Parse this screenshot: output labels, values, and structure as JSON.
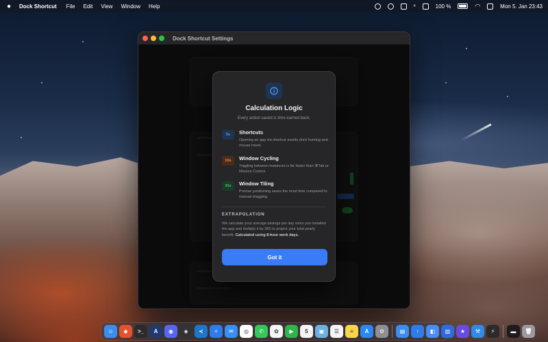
{
  "menubar": {
    "app_name": "Dock Shortcut",
    "menus": [
      "File",
      "Edit",
      "View",
      "Window",
      "Help"
    ],
    "battery": "100 %",
    "datetime": "Mon 5. Jan  23:43"
  },
  "window": {
    "title": "Dock Shortcut Settings"
  },
  "modal": {
    "icon": "info-icon",
    "title": "Calculation Logic",
    "subtitle": "Every action saved is time earned back.",
    "rows": [
      {
        "badge": "5s",
        "badge_color": "#5b9cf5",
        "title": "Shortcuts",
        "desc": "Opening an app via shortcut avoids dock hunting and mouse travel."
      },
      {
        "badge": "10s",
        "badge_color": "#f08a3c",
        "title": "Window Cycling",
        "desc": "Toggling between instances is far faster than ⌘Tab or Mission Control."
      },
      {
        "badge": "30s",
        "badge_color": "#4cc46a",
        "title": "Window Tiling",
        "desc": "Precise positioning saves the most time compared to manual dragging."
      }
    ],
    "extrapolation": {
      "heading": "EXTRAPOLATION",
      "body": "We calculate your average savings per day since you installed the app and multiply it by 365 to project your total yearly benefit.",
      "bold": "Calculated using 8-hour work days."
    },
    "button_label": "Got it",
    "button_color": "#3a7cf5"
  },
  "dock": {
    "icons": [
      {
        "name": "finder-icon",
        "color": "#3b8ef0",
        "glyph": "☺"
      },
      {
        "name": "brave-icon",
        "color": "#e2532d",
        "glyph": "◆"
      },
      {
        "name": "terminal-icon",
        "color": "#2b2b2b",
        "glyph": ">_"
      },
      {
        "name": "font-app-icon",
        "color": "#1e3a6e",
        "glyph": "A"
      },
      {
        "name": "discord-icon",
        "color": "#5865f2",
        "glyph": "◉"
      },
      {
        "name": "unity-icon",
        "color": "#333333",
        "glyph": "◈"
      },
      {
        "name": "vscode-icon",
        "color": "#1f76c9",
        "glyph": "≺"
      },
      {
        "name": "safari-icon",
        "color": "#2f7bea",
        "glyph": "✧"
      },
      {
        "name": "mail-icon",
        "color": "#3a8df5",
        "glyph": "✉"
      },
      {
        "name": "chrome-icon",
        "color": "#ffffff",
        "glyph": "◎"
      },
      {
        "name": "messages-icon",
        "color": "#34c759",
        "glyph": "✆"
      },
      {
        "name": "photos-icon",
        "color": "#f5f5f5",
        "glyph": "✿"
      },
      {
        "name": "facetime-icon",
        "color": "#2fb54a",
        "glyph": "▶"
      },
      {
        "name": "calendar-icon",
        "color": "#f5f5f5",
        "glyph": "5"
      },
      {
        "name": "preview-icon",
        "color": "#6ab0e0",
        "glyph": "▣"
      },
      {
        "name": "reminders-icon",
        "color": "#f5f5f5",
        "glyph": "☰"
      },
      {
        "name": "notes-icon",
        "color": "#f7d64a",
        "glyph": "≡"
      },
      {
        "name": "app-store-icon",
        "color": "#2b87f5",
        "glyph": "A"
      },
      {
        "name": "settings-icon",
        "color": "#8e8e93",
        "glyph": "⚙"
      },
      {
        "name": "finder-window-icon",
        "color": "#3b8ef0",
        "glyph": "▤"
      },
      {
        "name": "upload-icon",
        "color": "#2f7bea",
        "glyph": "↑"
      },
      {
        "name": "jira-icon",
        "color": "#4a8bf5",
        "glyph": "◧"
      },
      {
        "name": "keynote-icon",
        "color": "#2f6ae0",
        "glyph": "▥"
      },
      {
        "name": "star-app-icon",
        "color": "#6a4adf",
        "glyph": "★"
      },
      {
        "name": "xcode-icon",
        "color": "#2f8ae8",
        "glyph": "⚒"
      },
      {
        "name": "energy-icon",
        "color": "#2b2b2b",
        "glyph": "⚡"
      },
      {
        "name": "dock-shortcut-icon",
        "color": "#1c1c1e",
        "glyph": "▬"
      },
      {
        "name": "trash-icon",
        "color": "#9a9aa0",
        "glyph": "🗑"
      }
    ]
  }
}
